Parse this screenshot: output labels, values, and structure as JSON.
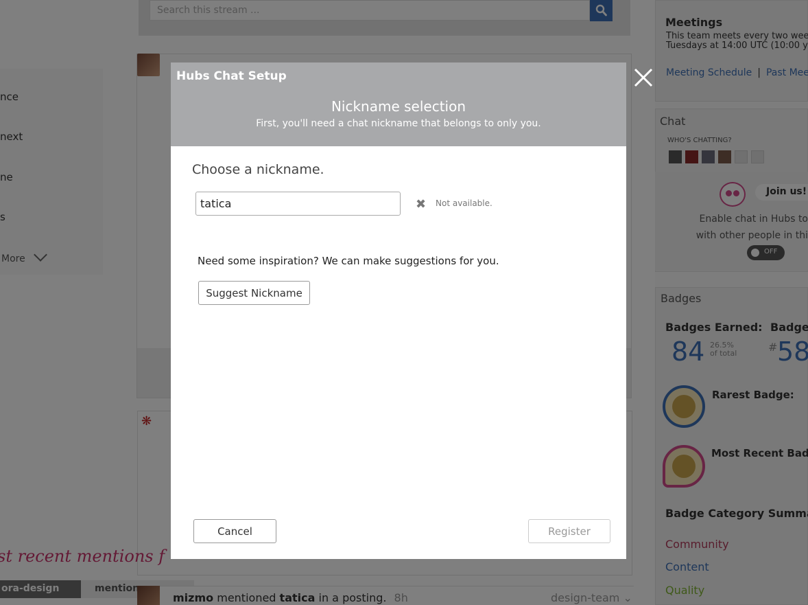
{
  "background": {
    "search": {
      "placeholder": "Search this stream ..."
    },
    "nav": {
      "items": [
        "nce",
        "next",
        "ne",
        "s"
      ],
      "more_label": "More"
    },
    "mentions": {
      "title": "st recent mentions f",
      "tabs": [
        "ora-design",
        "mentions"
      ],
      "row": {
        "user": "mizmo",
        "action_1": "mentioned",
        "target": "tatica",
        "action_2": "in a posting.",
        "time": "8h",
        "tag": "design-team"
      }
    },
    "meetings": {
      "title": "Meetings",
      "desc_line1": "This team meets every two wee",
      "desc_line2": "Tuesdays at 14:00 UTC (10:00 y",
      "link_schedule": "Meeting Schedule",
      "separator": "|",
      "link_past": "Past Meet"
    },
    "chat": {
      "title": "Chat",
      "whos_chatting": "WHO'S CHATTING?",
      "join_label": "Join us!",
      "enable_line1": "Enable chat in Hubs to",
      "enable_line2": "with other people in thi",
      "toggle_label": "OFF"
    },
    "badges": {
      "title": "Badges",
      "earned_label": "Badges Earned:",
      "earned_value": "84",
      "earned_pct": "26.5%",
      "earned_pct_sub": "of total",
      "rank_label": "Badge",
      "rank_hash": "#",
      "rank_value": "58",
      "rarest_label": "Rarest Badge:",
      "recent_label": "Most Recent Badg",
      "category_summary": "Badge Category Summary:",
      "categories": [
        {
          "name": "Community",
          "color": "#b03a5a"
        },
        {
          "name": "Content",
          "color": "#3c6eb4"
        },
        {
          "name": "Quality",
          "color": "#7fb332"
        }
      ]
    }
  },
  "modal": {
    "app_title": "Hubs Chat Setup",
    "title": "Nickname selection",
    "subtitle": "First, you'll need a chat nickname that belongs to only you.",
    "choose_label": "Choose a nickname.",
    "nickname_value": "tatica",
    "availability_icon": "x-icon",
    "availability_text": "Not available.",
    "inspiration_text": "Need some inspiration? We can make suggestions for you.",
    "suggest_button": "Suggest Nickname",
    "cancel_button": "Cancel",
    "register_button": "Register",
    "close_icon": "close-icon"
  },
  "colors": {
    "accent": "#3c6eb4",
    "modal_header": "#a8a9ab",
    "overlay": "rgba(0,0,0,0.5)",
    "mentions_pink": "#c8326a"
  }
}
